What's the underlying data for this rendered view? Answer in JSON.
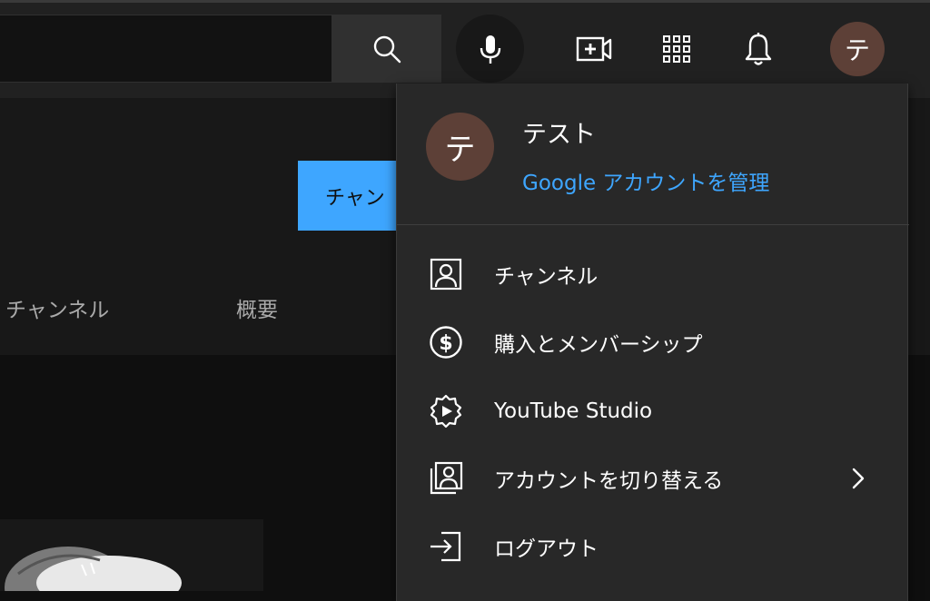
{
  "topbar": {
    "search_icon": "search-icon",
    "mic_icon": "mic-icon",
    "create_icon": "video-create-icon",
    "apps_icon": "apps-grid-icon",
    "notifications_icon": "bell-icon",
    "avatar_initial": "テ"
  },
  "channel": {
    "button_label": "チャン",
    "tabs": [
      {
        "label": "チャンネル"
      },
      {
        "label": "概要"
      }
    ]
  },
  "account_menu": {
    "avatar_initial": "テ",
    "user_name": "テスト",
    "manage_account": "Google アカウントを管理",
    "items": [
      {
        "label": "チャンネル",
        "icon": "person-icon"
      },
      {
        "label": "購入とメンバーシップ",
        "icon": "dollar-circle-icon"
      },
      {
        "label": "YouTube Studio",
        "icon": "studio-gear-icon"
      },
      {
        "label": "アカウントを切り替える",
        "icon": "switch-account-icon"
      },
      {
        "label": "ログアウト",
        "icon": "sign-out-icon"
      }
    ]
  },
  "colors": {
    "accent_blue": "#3ea6ff",
    "avatar_brown": "#5d4037",
    "menu_bg": "#282828",
    "topbar_bg": "#212121"
  }
}
